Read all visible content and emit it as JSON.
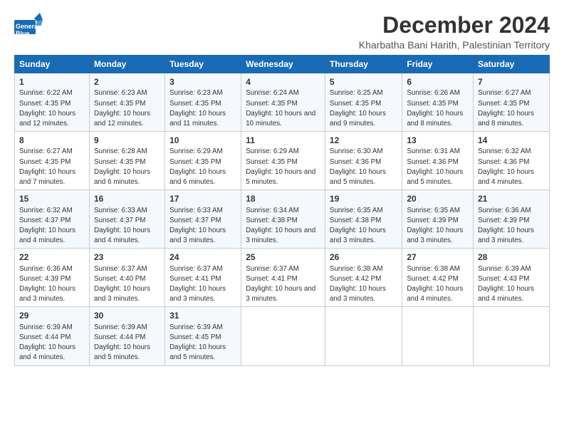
{
  "logo": {
    "line1": "General",
    "line2": "Blue"
  },
  "title": "December 2024",
  "subtitle": "Kharbatha Bani Harith, Palestinian Territory",
  "headers": [
    "Sunday",
    "Monday",
    "Tuesday",
    "Wednesday",
    "Thursday",
    "Friday",
    "Saturday"
  ],
  "weeks": [
    [
      {
        "day": "1",
        "sunrise": "6:22 AM",
        "sunset": "4:35 PM",
        "daylight": "10 hours and 12 minutes."
      },
      {
        "day": "2",
        "sunrise": "6:23 AM",
        "sunset": "4:35 PM",
        "daylight": "10 hours and 12 minutes."
      },
      {
        "day": "3",
        "sunrise": "6:23 AM",
        "sunset": "4:35 PM",
        "daylight": "10 hours and 11 minutes."
      },
      {
        "day": "4",
        "sunrise": "6:24 AM",
        "sunset": "4:35 PM",
        "daylight": "10 hours and 10 minutes."
      },
      {
        "day": "5",
        "sunrise": "6:25 AM",
        "sunset": "4:35 PM",
        "daylight": "10 hours and 9 minutes."
      },
      {
        "day": "6",
        "sunrise": "6:26 AM",
        "sunset": "4:35 PM",
        "daylight": "10 hours and 8 minutes."
      },
      {
        "day": "7",
        "sunrise": "6:27 AM",
        "sunset": "4:35 PM",
        "daylight": "10 hours and 8 minutes."
      }
    ],
    [
      {
        "day": "8",
        "sunrise": "6:27 AM",
        "sunset": "4:35 PM",
        "daylight": "10 hours and 7 minutes."
      },
      {
        "day": "9",
        "sunrise": "6:28 AM",
        "sunset": "4:35 PM",
        "daylight": "10 hours and 6 minutes."
      },
      {
        "day": "10",
        "sunrise": "6:29 AM",
        "sunset": "4:35 PM",
        "daylight": "10 hours and 6 minutes."
      },
      {
        "day": "11",
        "sunrise": "6:29 AM",
        "sunset": "4:35 PM",
        "daylight": "10 hours and 5 minutes."
      },
      {
        "day": "12",
        "sunrise": "6:30 AM",
        "sunset": "4:36 PM",
        "daylight": "10 hours and 5 minutes."
      },
      {
        "day": "13",
        "sunrise": "6:31 AM",
        "sunset": "4:36 PM",
        "daylight": "10 hours and 5 minutes."
      },
      {
        "day": "14",
        "sunrise": "6:32 AM",
        "sunset": "4:36 PM",
        "daylight": "10 hours and 4 minutes."
      }
    ],
    [
      {
        "day": "15",
        "sunrise": "6:32 AM",
        "sunset": "4:37 PM",
        "daylight": "10 hours and 4 minutes."
      },
      {
        "day": "16",
        "sunrise": "6:33 AM",
        "sunset": "4:37 PM",
        "daylight": "10 hours and 4 minutes."
      },
      {
        "day": "17",
        "sunrise": "6:33 AM",
        "sunset": "4:37 PM",
        "daylight": "10 hours and 3 minutes."
      },
      {
        "day": "18",
        "sunrise": "6:34 AM",
        "sunset": "4:38 PM",
        "daylight": "10 hours and 3 minutes."
      },
      {
        "day": "19",
        "sunrise": "6:35 AM",
        "sunset": "4:38 PM",
        "daylight": "10 hours and 3 minutes."
      },
      {
        "day": "20",
        "sunrise": "6:35 AM",
        "sunset": "4:39 PM",
        "daylight": "10 hours and 3 minutes."
      },
      {
        "day": "21",
        "sunrise": "6:36 AM",
        "sunset": "4:39 PM",
        "daylight": "10 hours and 3 minutes."
      }
    ],
    [
      {
        "day": "22",
        "sunrise": "6:36 AM",
        "sunset": "4:39 PM",
        "daylight": "10 hours and 3 minutes."
      },
      {
        "day": "23",
        "sunrise": "6:37 AM",
        "sunset": "4:40 PM",
        "daylight": "10 hours and 3 minutes."
      },
      {
        "day": "24",
        "sunrise": "6:37 AM",
        "sunset": "4:41 PM",
        "daylight": "10 hours and 3 minutes."
      },
      {
        "day": "25",
        "sunrise": "6:37 AM",
        "sunset": "4:41 PM",
        "daylight": "10 hours and 3 minutes."
      },
      {
        "day": "26",
        "sunrise": "6:38 AM",
        "sunset": "4:42 PM",
        "daylight": "10 hours and 3 minutes."
      },
      {
        "day": "27",
        "sunrise": "6:38 AM",
        "sunset": "4:42 PM",
        "daylight": "10 hours and 4 minutes."
      },
      {
        "day": "28",
        "sunrise": "6:39 AM",
        "sunset": "4:43 PM",
        "daylight": "10 hours and 4 minutes."
      }
    ],
    [
      {
        "day": "29",
        "sunrise": "6:39 AM",
        "sunset": "4:44 PM",
        "daylight": "10 hours and 4 minutes."
      },
      {
        "day": "30",
        "sunrise": "6:39 AM",
        "sunset": "4:44 PM",
        "daylight": "10 hours and 5 minutes."
      },
      {
        "day": "31",
        "sunrise": "6:39 AM",
        "sunset": "4:45 PM",
        "daylight": "10 hours and 5 minutes."
      },
      null,
      null,
      null,
      null
    ]
  ],
  "labels": {
    "sunrise": "Sunrise:",
    "sunset": "Sunset:",
    "daylight": "Daylight:"
  }
}
